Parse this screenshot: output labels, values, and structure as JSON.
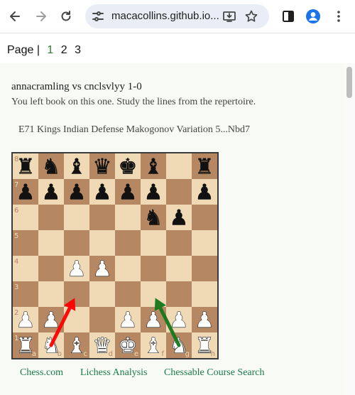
{
  "browser": {
    "url": "macacollins.github.io...",
    "icons": {
      "back": "back-arrow-icon",
      "forward": "forward-arrow-icon",
      "reload": "reload-icon",
      "site_settings": "tune-icon",
      "install": "install-app-icon",
      "bookmark": "star-icon",
      "side_panel": "side-panel-icon",
      "profile": "profile-avatar-icon"
    }
  },
  "pager": {
    "label": "Page |",
    "pages": [
      "1",
      "2",
      "3"
    ],
    "current": "1"
  },
  "game": {
    "title": "annacramling vs cnclsvlyy 1-0",
    "note": "You left book on this one. Study the lines from the repertoire.",
    "opening": "E71 Kings Indian Defense Makogonov Variation 5...Nbd7"
  },
  "board": {
    "light_color": "#f0d9b5",
    "dark_color": "#b58863",
    "orientation": "white",
    "rank_labels": [
      "8",
      "7",
      "6",
      "5",
      "4",
      "3",
      "2",
      "1"
    ],
    "file_labels": [
      "a",
      "b",
      "c",
      "d",
      "e",
      "f",
      "g",
      "h"
    ],
    "position": [
      [
        "r",
        "n",
        "b",
        "q",
        "k",
        "b",
        "",
        "r"
      ],
      [
        "p",
        "p",
        "p",
        "p",
        "p",
        "p",
        "",
        "p"
      ],
      [
        "",
        "",
        "",
        "",
        "",
        "n",
        "p",
        ""
      ],
      [
        "",
        "",
        "",
        "",
        "",
        "",
        "",
        ""
      ],
      [
        "",
        "",
        "P",
        "P",
        "",
        "",
        "",
        ""
      ],
      [
        "",
        "",
        "",
        "",
        "",
        "",
        "",
        ""
      ],
      [
        "P",
        "P",
        "",
        "",
        "P",
        "P",
        "P",
        "P"
      ],
      [
        "R",
        "N",
        "B",
        "Q",
        "K",
        "B",
        "N",
        "R"
      ]
    ],
    "arrows": [
      {
        "from": "b1",
        "to": "c3",
        "color": "#ff0000"
      },
      {
        "from": "g1",
        "to": "f3",
        "color": "#15781b"
      }
    ]
  },
  "links": [
    {
      "label": "Chess.com"
    },
    {
      "label": "Lichess Analysis"
    },
    {
      "label": "Chessable Course Search"
    }
  ]
}
